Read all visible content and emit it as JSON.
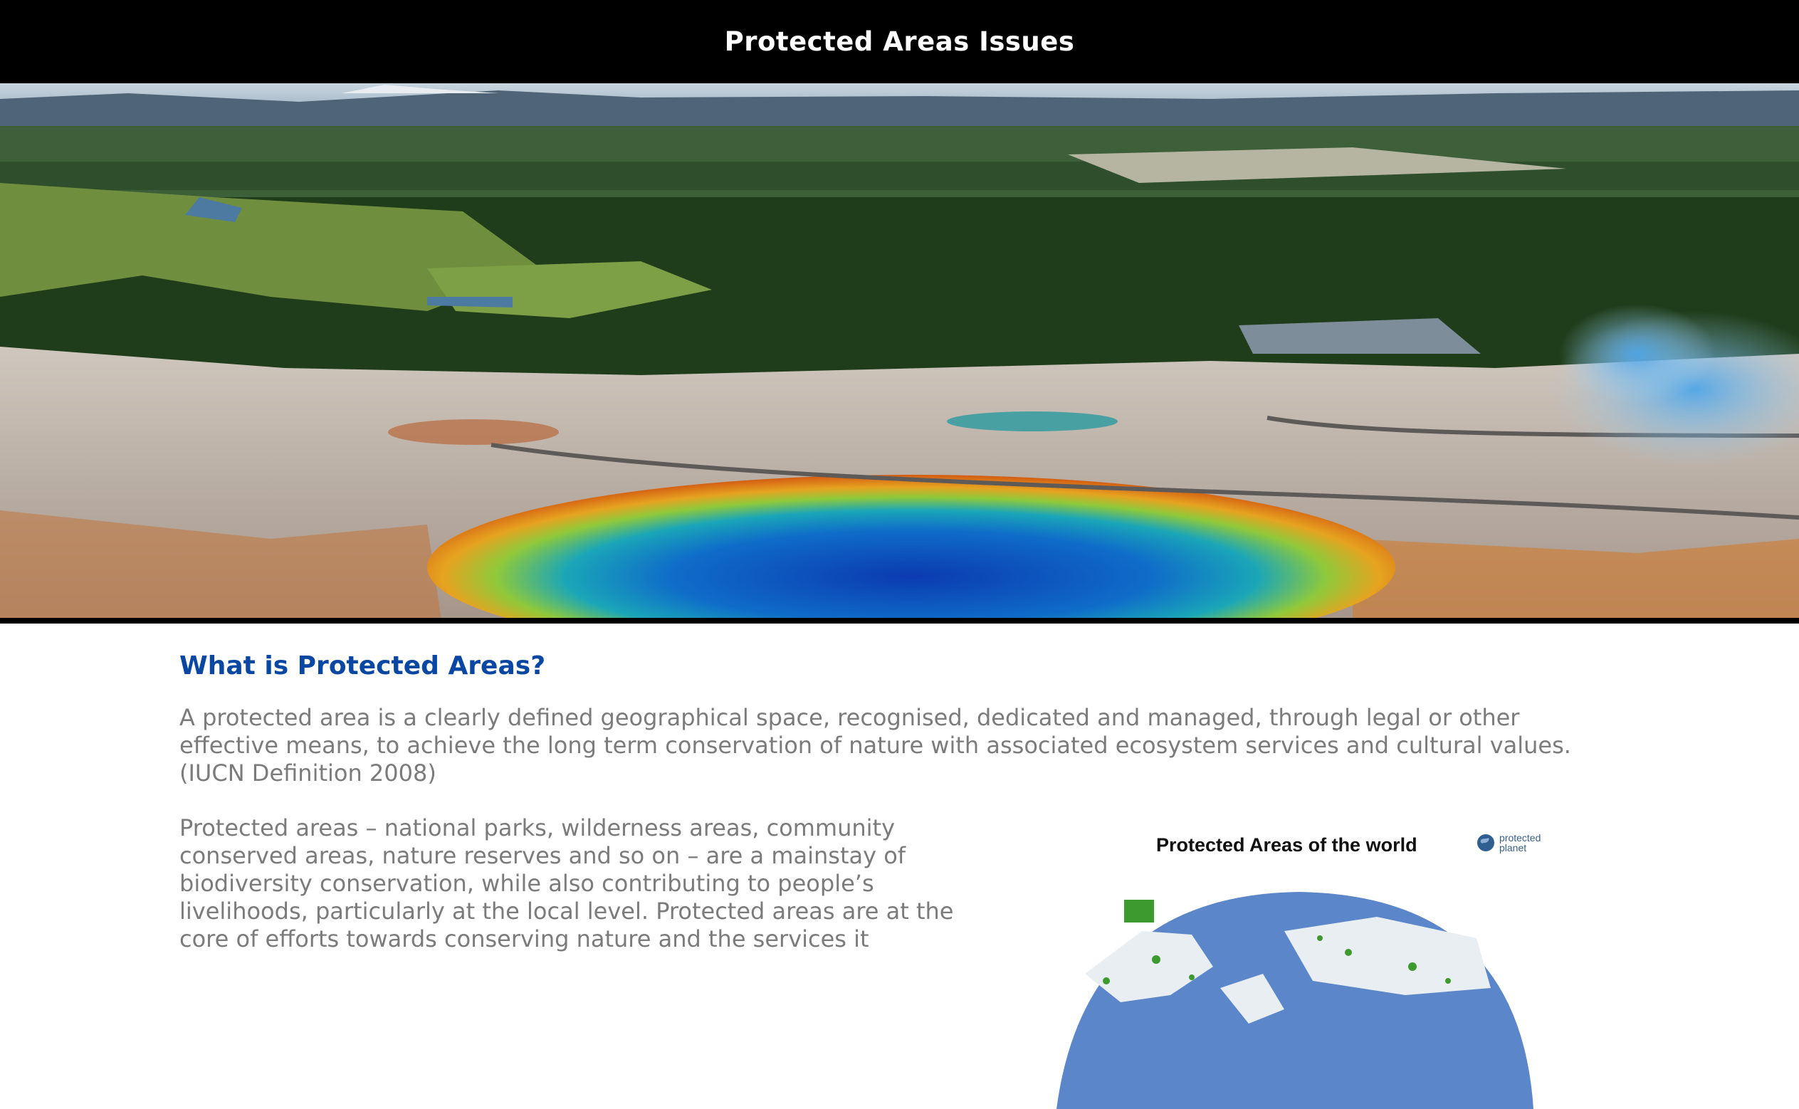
{
  "header": {
    "title": "Protected Areas Issues"
  },
  "section": {
    "heading": "What is Protected Areas?",
    "paragraph_1": "A protected area is a clearly defined geographical space, recognised, dedicated and managed, through legal or other effective means, to achieve the long term conservation of nature with associated ecosystem services and cultural values. (IUCN Definition 2008)",
    "paragraph_2": "Protected areas – national parks, wilderness areas, community conserved areas, nature reserves and so on – are a mainstay of biodiversity conservation, while also contributing to people’s livelihoods, particularly at the local level. Protected areas are at the core of efforts towards conserving nature and the services it"
  },
  "map_figure": {
    "title": "Protected Areas of the world",
    "logo_line_1": "protected",
    "logo_line_2": "planet"
  },
  "colors": {
    "header_bg": "#000000",
    "header_text": "#ffffff",
    "heading": "#0a47a3",
    "body_text": "#7b7b7b"
  }
}
